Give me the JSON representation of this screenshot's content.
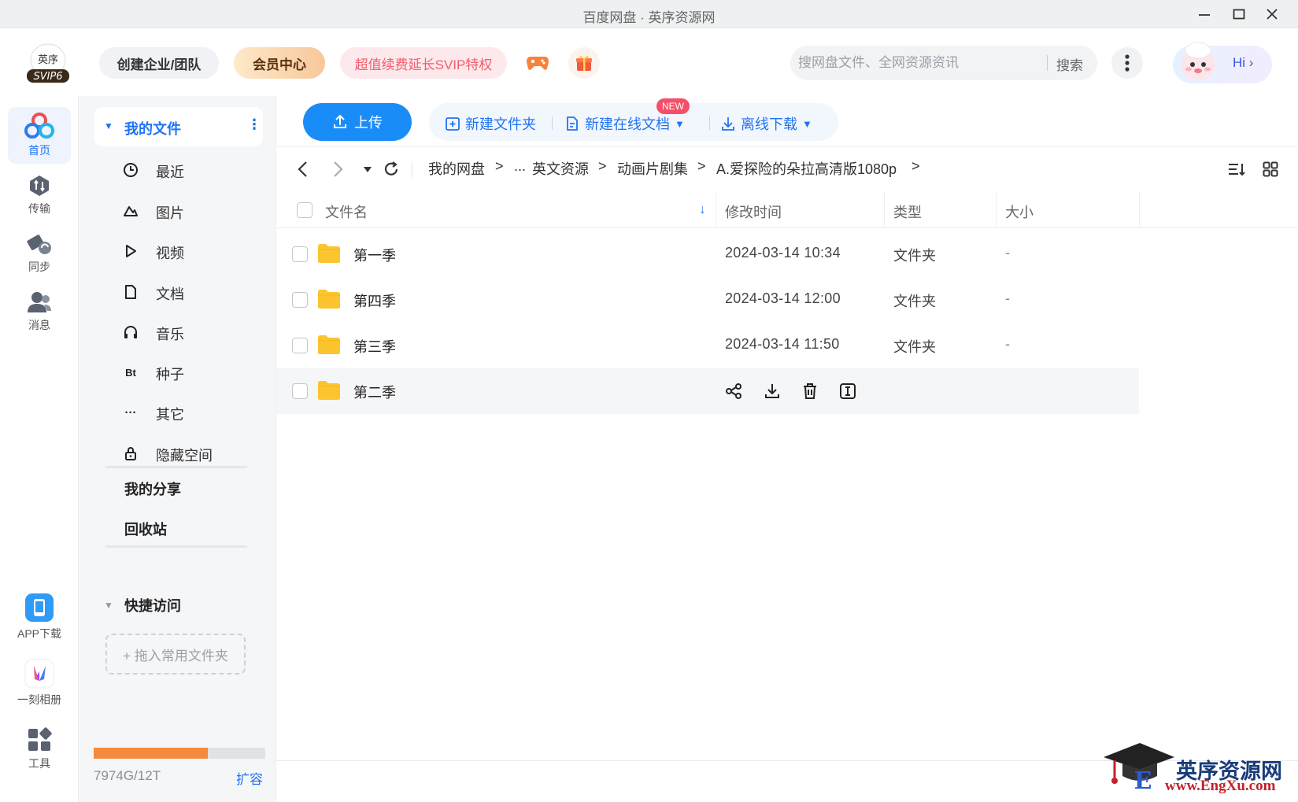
{
  "window": {
    "title": "百度网盘 · 英序资源网",
    "controls": [
      "minimize",
      "maximize",
      "close"
    ]
  },
  "header": {
    "logo_badge": "SVIP6",
    "logo_text": "英序",
    "team_button": "创建企业/团队",
    "vip_button": "会员中心",
    "svip_button": "超值续费延长SVIP特权",
    "search": {
      "placeholder": "搜网盘文件、全网资源资讯",
      "button": "搜索"
    },
    "hi_label": "Hi"
  },
  "rail": {
    "items": [
      {
        "label": "首页",
        "icon": "home-icon",
        "active": true
      },
      {
        "label": "传输",
        "icon": "transfer-icon"
      },
      {
        "label": "同步",
        "icon": "sync-icon"
      },
      {
        "label": "消息",
        "icon": "message-icon"
      }
    ],
    "bottom": [
      {
        "label": "APP下载",
        "icon": "phone-icon"
      },
      {
        "label": "一刻相册",
        "icon": "album-icon"
      },
      {
        "label": "工具",
        "icon": "tools-icon"
      }
    ]
  },
  "sidebar": {
    "my_files": "我的文件",
    "items": [
      {
        "label": "最近",
        "icon": "clock-icon"
      },
      {
        "label": "图片",
        "icon": "image-icon"
      },
      {
        "label": "视频",
        "icon": "video-icon"
      },
      {
        "label": "文档",
        "icon": "document-icon"
      },
      {
        "label": "音乐",
        "icon": "music-icon"
      },
      {
        "label": "种子",
        "icon": "bt-icon",
        "glyph": "Bt"
      },
      {
        "label": "其它",
        "icon": "more-icon",
        "glyph": "···"
      },
      {
        "label": "隐藏空间",
        "icon": "lock-icon"
      }
    ],
    "my_share": "我的分享",
    "recycle": "回收站",
    "quick_access": "快捷访问",
    "drag_hint": "+ 拖入常用文件夹",
    "quota": {
      "used_fraction": 0.6645,
      "text": "7974G/12T",
      "expand": "扩容"
    }
  },
  "toolbar": {
    "upload": "上传",
    "new_folder": "新建文件夹",
    "new_online_doc": "新建在线文档",
    "new_badge": "NEW",
    "offline_download": "离线下载"
  },
  "breadcrumb": {
    "items": [
      "我的网盘",
      "...",
      "英文资源",
      "动画片剧集",
      "A.爱探险的朵拉高清版1080p"
    ],
    "separator": ">"
  },
  "table": {
    "headers": {
      "name": "文件名",
      "mtime": "修改时间",
      "type": "类型",
      "size": "大小"
    },
    "rows": [
      {
        "name": "第一季",
        "mtime": "2024-03-14 10:34",
        "type": "文件夹",
        "size": "-"
      },
      {
        "name": "第四季",
        "mtime": "2024-03-14 12:00",
        "type": "文件夹",
        "size": "-"
      },
      {
        "name": "第三季",
        "mtime": "2024-03-14 11:50",
        "type": "文件夹",
        "size": "-"
      },
      {
        "name": "第二季",
        "mtime": "",
        "type": "",
        "size": "",
        "hovered": true
      }
    ],
    "row_actions": [
      "share-icon",
      "download-icon",
      "delete-icon",
      "rename-icon"
    ]
  },
  "watermark": {
    "title": "英序资源网",
    "url": "www.EngXu.com"
  },
  "colors": {
    "accent": "#1f74f2",
    "upload": "#1a8cf8",
    "quota": "#f58a3c",
    "folder": "#fcc52f"
  }
}
